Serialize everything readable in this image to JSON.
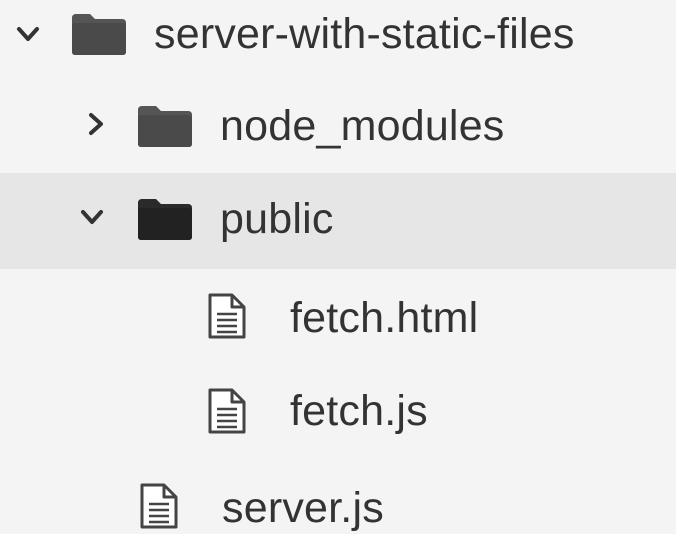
{
  "colors": {
    "background": "#f4f4f4",
    "selected_row": "#e6e6e6",
    "text": "#333333",
    "folder_closed": "#555555",
    "folder_open": "#2a2a2a",
    "file_icon": "#444444"
  },
  "tree": {
    "root": {
      "label": "server-with-static-files",
      "icon": "folder-icon",
      "chevron": "chevron-down-icon",
      "expanded": true
    },
    "node_modules": {
      "label": "node_modules",
      "icon": "folder-icon",
      "chevron": "chevron-right-icon",
      "expanded": false
    },
    "public": {
      "label": "public",
      "icon": "folder-icon",
      "chevron": "chevron-down-icon",
      "expanded": true,
      "selected": true
    },
    "fetch_html": {
      "label": "fetch.html",
      "icon": "file-icon"
    },
    "fetch_js": {
      "label": "fetch.js",
      "icon": "file-icon"
    },
    "server_js": {
      "label": "server.js",
      "icon": "file-icon"
    }
  }
}
